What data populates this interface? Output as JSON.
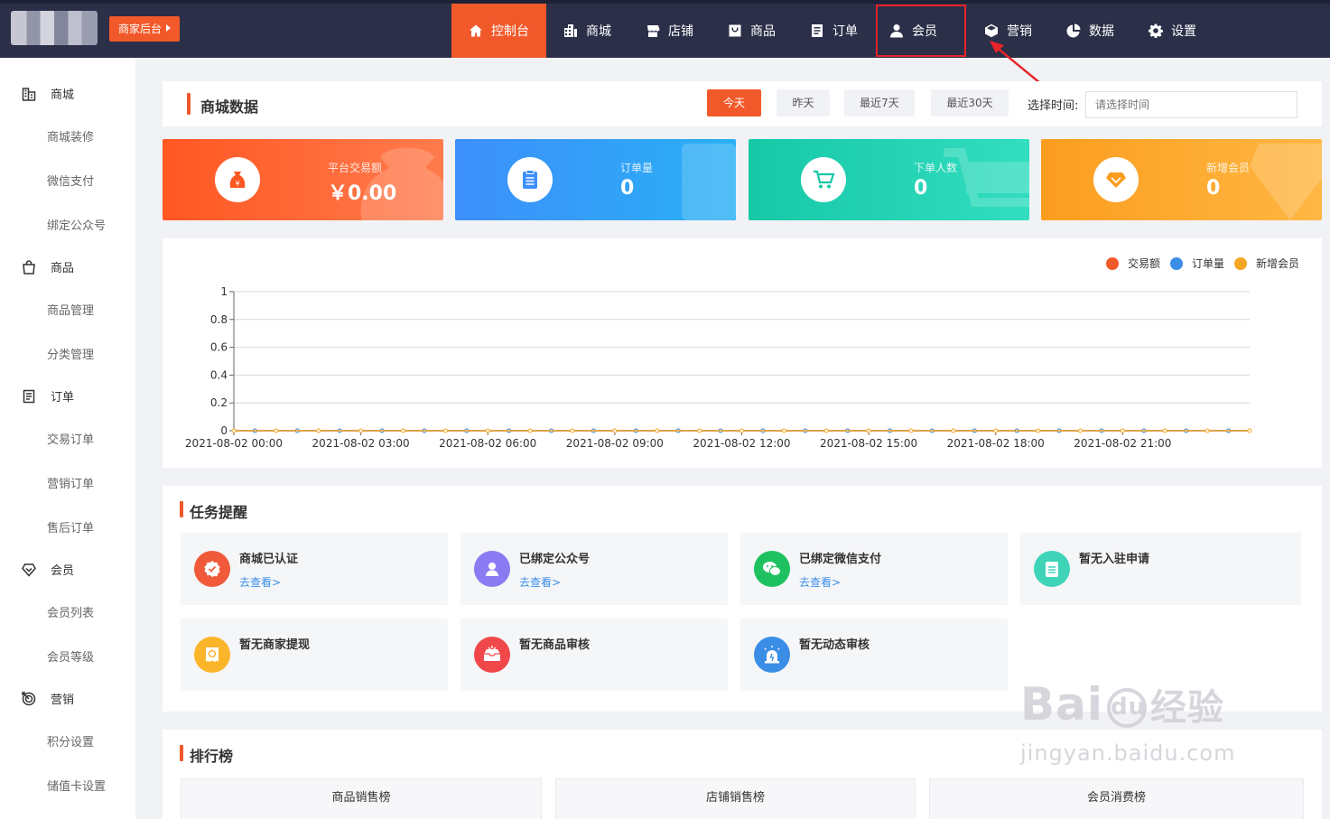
{
  "header": {
    "merchant_button": "商家后台",
    "nav": [
      {
        "label": "控制台",
        "icon": "home-icon",
        "active": true
      },
      {
        "label": "商城",
        "icon": "building-icon"
      },
      {
        "label": "店铺",
        "icon": "store-icon"
      },
      {
        "label": "商品",
        "icon": "bag-icon"
      },
      {
        "label": "订单",
        "icon": "clipboard-icon"
      },
      {
        "label": "会员",
        "icon": "user-icon",
        "highlighted": true
      },
      {
        "label": "营销",
        "icon": "cube-icon"
      },
      {
        "label": "数据",
        "icon": "pie-icon"
      },
      {
        "label": "设置",
        "icon": "gear-icon"
      }
    ],
    "active_color": "#f2592a",
    "highlight_color": "#e8242a"
  },
  "sidebar": {
    "groups": [
      {
        "label": "商城",
        "icon": "building-icon",
        "items": [
          "商城装修",
          "微信支付",
          "绑定公众号"
        ]
      },
      {
        "label": "商品",
        "icon": "bag-icon",
        "items": [
          "商品管理",
          "分类管理"
        ]
      },
      {
        "label": "订单",
        "icon": "clipboard-icon",
        "items": [
          "交易订单",
          "营销订单",
          "售后订单"
        ]
      },
      {
        "label": "会员",
        "icon": "diamond-icon",
        "items": [
          "会员列表",
          "会员等级"
        ]
      },
      {
        "label": "营销",
        "icon": "target-icon",
        "items": [
          "积分设置",
          "储值卡设置"
        ]
      }
    ]
  },
  "mall_data": {
    "title": "商城数据",
    "ranges": [
      "今天",
      "昨天",
      "最近7天",
      "最近30天"
    ],
    "active_range": "今天",
    "time_label": "选择时间:",
    "time_placeholder": "请选择时间"
  },
  "stats": [
    {
      "label": "平台交易额",
      "value": "￥0.00",
      "icon": "money-bag-icon",
      "color_start": "#ff5722",
      "color_end": "#ff7b4d"
    },
    {
      "label": "订单量",
      "value": "0",
      "icon": "clipboard-icon",
      "color_start": "#3d8ffb",
      "color_end": "#2ab0f5"
    },
    {
      "label": "下单人数",
      "value": "0",
      "icon": "cart-icon",
      "color_start": "#17c8a7",
      "color_end": "#32ddc0"
    },
    {
      "label": "新增会员",
      "value": "0",
      "icon": "diamond-icon",
      "color_start": "#fb9d1f",
      "color_end": "#ffb743"
    }
  ],
  "chart_data": {
    "type": "line",
    "x": [
      "2021-08-02 00:00",
      "2021-08-02 01:00",
      "2021-08-02 02:00",
      "2021-08-02 03:00",
      "2021-08-02 04:00",
      "2021-08-02 05:00",
      "2021-08-02 06:00",
      "2021-08-02 07:00",
      "2021-08-02 08:00",
      "2021-08-02 09:00",
      "2021-08-02 10:00",
      "2021-08-02 11:00",
      "2021-08-02 12:00",
      "2021-08-02 13:00",
      "2021-08-02 14:00",
      "2021-08-02 15:00",
      "2021-08-02 16:00",
      "2021-08-02 17:00",
      "2021-08-02 18:00",
      "2021-08-02 19:00",
      "2021-08-02 20:00",
      "2021-08-02 21:00",
      "2021-08-02 22:00",
      "2021-08-02 23:00"
    ],
    "x_tick_labels": [
      "2021-08-02 00:00",
      "2021-08-02 03:00",
      "2021-08-02 06:00",
      "2021-08-02 09:00",
      "2021-08-02 12:00",
      "2021-08-02 15:00",
      "2021-08-02 18:00",
      "2021-08-02 21:00"
    ],
    "series": [
      {
        "name": "交易额",
        "color": "#f05a28",
        "values": [
          0,
          0,
          0,
          0,
          0,
          0,
          0,
          0,
          0,
          0,
          0,
          0,
          0,
          0,
          0,
          0,
          0,
          0,
          0,
          0,
          0,
          0,
          0,
          0
        ]
      },
      {
        "name": "订单量",
        "color": "#3a8ee6",
        "values": [
          0,
          0,
          0,
          0,
          0,
          0,
          0,
          0,
          0,
          0,
          0,
          0,
          0,
          0,
          0,
          0,
          0,
          0,
          0,
          0,
          0,
          0,
          0,
          0
        ]
      },
      {
        "name": "新增会员",
        "color": "#f5a623",
        "values": [
          0,
          0,
          0,
          0,
          0,
          0,
          0,
          0,
          0,
          0,
          0,
          0,
          0,
          0,
          0,
          0,
          0,
          0,
          0,
          0,
          0,
          0,
          0,
          0
        ]
      }
    ],
    "y_ticks": [
      "0",
      "0.2",
      "0.4",
      "0.6",
      "0.8",
      "1"
    ],
    "ylim": [
      0,
      1
    ],
    "grid": true,
    "legend": "top-right"
  },
  "tasks": {
    "title": "任务提醒",
    "link_label": "去查看>",
    "items": [
      {
        "name": "商城已认证",
        "icon": "verified-icon",
        "color": "#f05a3a",
        "link": true
      },
      {
        "name": "已绑定公众号",
        "icon": "user-icon",
        "color": "#8b7bf2",
        "link": true
      },
      {
        "name": "已绑定微信支付",
        "icon": "wechat-icon",
        "color": "#1ec15f",
        "link": true
      },
      {
        "name": "暂无入驻申请",
        "icon": "clipboard-icon",
        "color": "#3fd3b8",
        "link": false
      },
      {
        "name": "暂无商家提现",
        "icon": "wallet-icon",
        "color": "#fbb52b",
        "link": false
      },
      {
        "name": "暂无商品审核",
        "icon": "inbox-icon",
        "color": "#f0484a",
        "link": false
      },
      {
        "name": "暂无动态审核",
        "icon": "alarm-icon",
        "color": "#3a8ee6",
        "link": false
      }
    ]
  },
  "ranking": {
    "title": "排行榜",
    "tabs": [
      "商品销售榜",
      "店铺销售榜",
      "会员消费榜"
    ]
  },
  "watermark": {
    "brand": "Bai",
    "brand2": "du",
    "brand3": "经验",
    "url": "jingyan.baidu.com"
  }
}
